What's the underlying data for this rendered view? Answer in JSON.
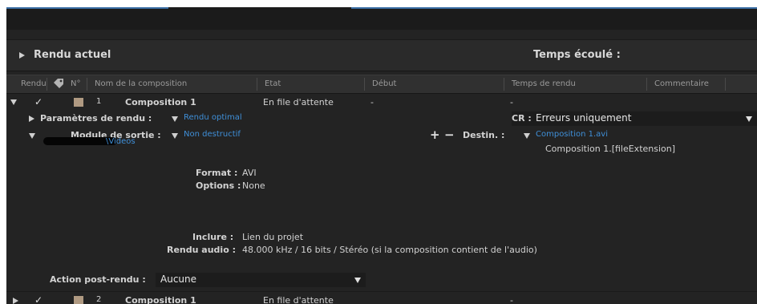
{
  "section": {
    "title": "Rendu actuel",
    "time_label": "Temps écoulé :"
  },
  "columns": [
    "Rendu",
    "N°",
    "Nom de la composition",
    "Etat",
    "Début",
    "Temps de rendu",
    "Commentaire"
  ],
  "items": [
    {
      "check": "✓",
      "number": "1",
      "name": "Composition 1",
      "status": "En file d'attente",
      "start": "-",
      "render_time": "-"
    },
    {
      "check": "✓",
      "number": "2",
      "name": "Composition 1",
      "status": "En file d'attente",
      "start": "-",
      "render_time": "-"
    }
  ],
  "render_settings": {
    "label": "Paramètres de rendu :",
    "value": "Rendu optimal"
  },
  "log": {
    "label": "CR :",
    "value": "Erreurs uniquement"
  },
  "output_module": {
    "label": "Module de sortie :",
    "value": "Non destructif"
  },
  "output_to": {
    "label": "Destin. :",
    "value": "Composition 1.avi"
  },
  "path_text": "\\Videos",
  "file_template": "Composition 1.[fileExtension]",
  "details": {
    "format_label": "Format :",
    "format_value": "AVI",
    "options_label": "Options :",
    "options_value": "None",
    "include_label": "Inclure :",
    "include_value": "Lien du projet",
    "audio_label": "Rendu audio :",
    "audio_value": "48.000 kHz / 16 bits / Stéréo (si la composition contient de l'audio)"
  },
  "post_render": {
    "label": "Action post-rendu :",
    "value": "Aucune"
  },
  "icons": {
    "plus": "+",
    "minus": "−",
    "label_tag": "tag-icon"
  },
  "colors": {
    "panel": "#232323",
    "link": "#3f8fd8",
    "label_swatch": "#b09a82"
  }
}
